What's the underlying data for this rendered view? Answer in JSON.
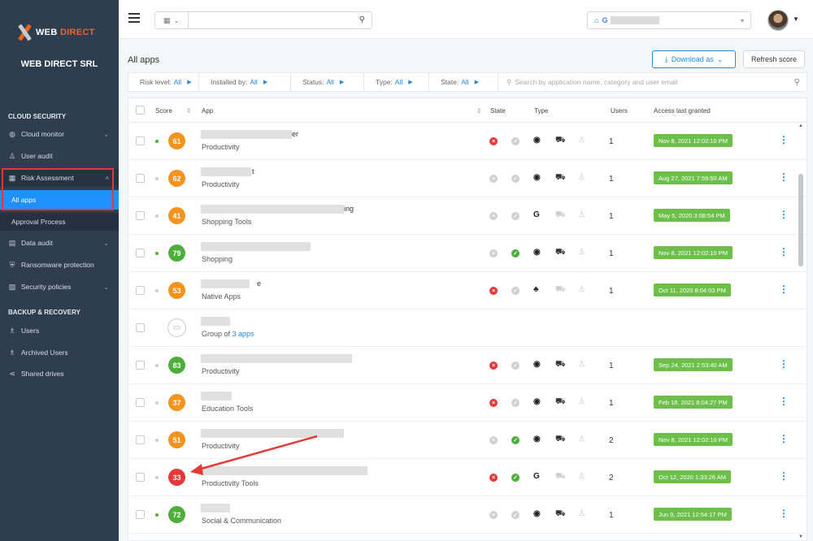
{
  "sidebar": {
    "logo_text_1": "WEB",
    "logo_text_2": "DIRECT",
    "company": "WEB DIRECT SRL",
    "sections": {
      "cloud_security": "CLOUD SECURITY",
      "backup_recovery": "BACKUP & RECOVERY"
    },
    "items": {
      "cloud_monitor": "Cloud monitor",
      "user_audit": "User audit",
      "risk_assessment": "Risk Assessment",
      "all_apps": "All apps",
      "approval_process": "Approval Process",
      "data_audit": "Data audit",
      "ransomware": "Ransomware protection",
      "security_policies": "Security policies",
      "users": "Users",
      "archived_users": "Archived Users",
      "shared_drives": "Shared drives"
    }
  },
  "topbar": {
    "account_letter": "G"
  },
  "content": {
    "title": "All apps",
    "download_label": "Download as",
    "refresh_label": "Refresh score"
  },
  "filters": {
    "risk_label": "Risk level:",
    "risk_value": "All",
    "installed_label": "Installed by:",
    "installed_value": "All",
    "status_label": "Status:",
    "status_value": "All",
    "type_label": "Type:",
    "type_value": "All",
    "state_label": "State:",
    "state_value": "All",
    "search_placeholder": "Search by application name, category and user email"
  },
  "table": {
    "headers": {
      "score": "Score",
      "app": "App",
      "state": "State",
      "type": "Type",
      "users": "Users",
      "access": "Access last granted"
    },
    "rows": [
      {
        "score": "61",
        "frag": "er",
        "category": "Productivity",
        "users": "1",
        "access": "Nov 8, 2021 12:02:10 PM"
      },
      {
        "score": "62",
        "frag": "t",
        "category": "Productivity",
        "users": "1",
        "access": "Aug 27, 2021 7:59:50 AM"
      },
      {
        "score": "41",
        "frag": "ing",
        "category": "Shopping Tools",
        "users": "1",
        "access": "May 5, 2020 3:08:54 PM"
      },
      {
        "score": "79",
        "frag": "",
        "category": "Shopping",
        "users": "1",
        "access": "Nov 8, 2021 12:02:10 PM"
      },
      {
        "score": "53",
        "frag": "e",
        "category": "Native Apps",
        "users": "1",
        "access": "Oct 11, 2020 8:04:03 PM"
      },
      {
        "group_prefix": "Group of",
        "group_link": "3 apps"
      },
      {
        "score": "83",
        "frag": "",
        "category": "Productivity",
        "users": "1",
        "access": "Sep 24, 2021 2:53:40 AM"
      },
      {
        "score": "37",
        "frag": "",
        "category": "Education Tools",
        "users": "1",
        "access": "Feb 18, 2021 8:04:27 PM"
      },
      {
        "score": "51",
        "frag": "",
        "category": "Productivity",
        "users": "2",
        "access": "Nov 8, 2021 12:02:10 PM"
      },
      {
        "score": "33",
        "frag": "",
        "category": "Productivity Tools",
        "users": "2",
        "access": "Oct 12, 2020 1:33:26 AM"
      },
      {
        "score": "72",
        "frag": "",
        "category": "Social & Communication",
        "users": "1",
        "access": "Jun 9, 2021 12:54:17 PM"
      }
    ]
  },
  "colors": {
    "sidebar_bg": "#2f3e4e",
    "accent": "#1e88e5",
    "access_badge": "#6cc04a",
    "score_orange": "#f5931e",
    "score_green": "#4caf3a",
    "score_red": "#e53935"
  }
}
